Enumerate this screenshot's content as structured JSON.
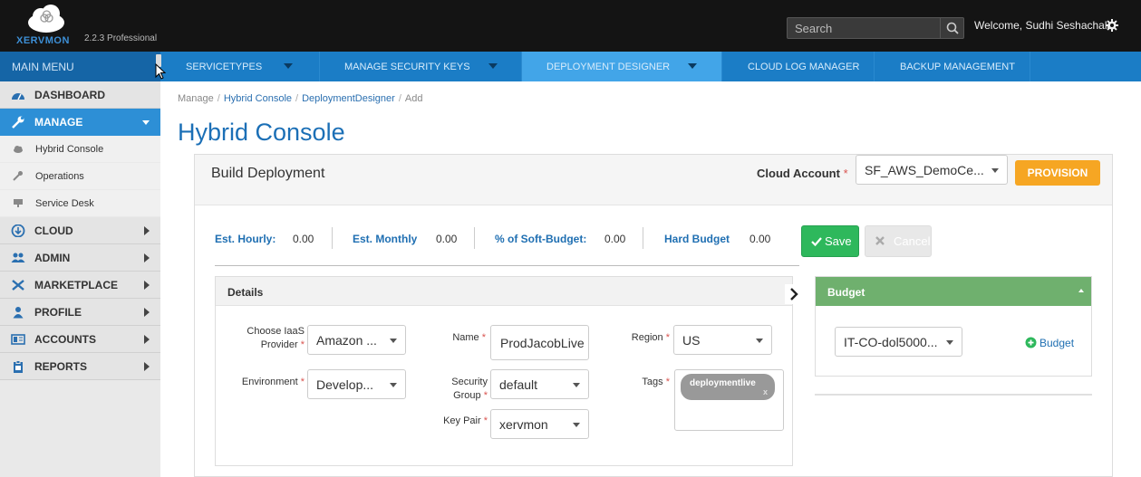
{
  "app": {
    "brand": "XERVMON",
    "version": "2.2.3 Professional",
    "search_placeholder": "Search",
    "welcome": "Welcome, Sudhi Seshachala",
    "colors": {
      "header_bg": "#141414",
      "nav_bg": "#1b7dc6",
      "active_nav": "#42a5e8",
      "title": "#1b6fb6",
      "provision": "#f6a623",
      "save": "#2eb85c",
      "budget_head": "#6fb06e"
    }
  },
  "nav": {
    "main_menu": "MAIN MENU",
    "tabs": [
      {
        "label": "SERVICETYPES"
      },
      {
        "label": "MANAGE SECURITY KEYS"
      },
      {
        "label": "DEPLOYMENT DESIGNER"
      },
      {
        "label": "CLOUD LOG MANAGER"
      },
      {
        "label": "BACKUP MANAGEMENT"
      }
    ]
  },
  "sidebar": {
    "items": [
      {
        "label": "DASHBOARD",
        "icon": "dashboard-icon"
      },
      {
        "label": "MANAGE",
        "icon": "wrench-icon"
      },
      {
        "label": "CLOUD",
        "icon": "cloud-icon"
      },
      {
        "label": "ADMIN",
        "icon": "users-icon"
      },
      {
        "label": "MARKETPLACE",
        "icon": "tools-icon"
      },
      {
        "label": "PROFILE",
        "icon": "user-icon"
      },
      {
        "label": "ACCOUNTS",
        "icon": "accounts-icon"
      },
      {
        "label": "REPORTS",
        "icon": "clipboard-icon"
      }
    ],
    "sub_items": [
      {
        "label": "Hybrid Console",
        "icon": "cloud-small-icon"
      },
      {
        "label": "Operations",
        "icon": "wrench-small-icon"
      },
      {
        "label": "Service Desk",
        "icon": "desk-icon"
      }
    ]
  },
  "breadcrumb": {
    "root": "Manage",
    "crumb1": "Hybrid Console",
    "crumb2": "DeploymentDesigner",
    "current": "Add",
    "sep": "/"
  },
  "page_title": "Hybrid Console",
  "build": {
    "title": "Build Deployment",
    "cloud_account_label": "Cloud Account",
    "required_mark": "*",
    "cloud_account_value": "SF_AWS_DemoCe...",
    "provision_label": "PROVISION",
    "est_hourly_label": "Est. Hourly:",
    "est_hourly_value": "0.00",
    "est_monthly_label": "Est. Monthly",
    "est_monthly_value": "0.00",
    "soft_budget_label": "% of Soft-Budget:",
    "soft_budget_value": "0.00",
    "hard_budget_label": "Hard Budget",
    "hard_budget_value": "0.00",
    "save_label": "Save",
    "cancel_label": "Cancel"
  },
  "details": {
    "title": "Details",
    "iaas_label_1": "Choose IaaS",
    "iaas_label_2": "Provider",
    "iaas_value": "Amazon ...",
    "environment_label": "Environment",
    "environment_value": "Develop...",
    "name_label": "Name",
    "name_value": "ProdJacobLive",
    "security_label_1": "Security",
    "security_label_2": "Group",
    "security_value": "default",
    "keypair_label": "Key Pair",
    "keypair_value": "xervmon",
    "region_label": "Region",
    "region_value": "US",
    "tags_label": "Tags",
    "tags": [
      {
        "label": "deploymentlive",
        "remove": "x"
      }
    ]
  },
  "budget": {
    "title": "Budget",
    "select_value": "IT-CO-dol5000...",
    "add_label": "Budget"
  }
}
